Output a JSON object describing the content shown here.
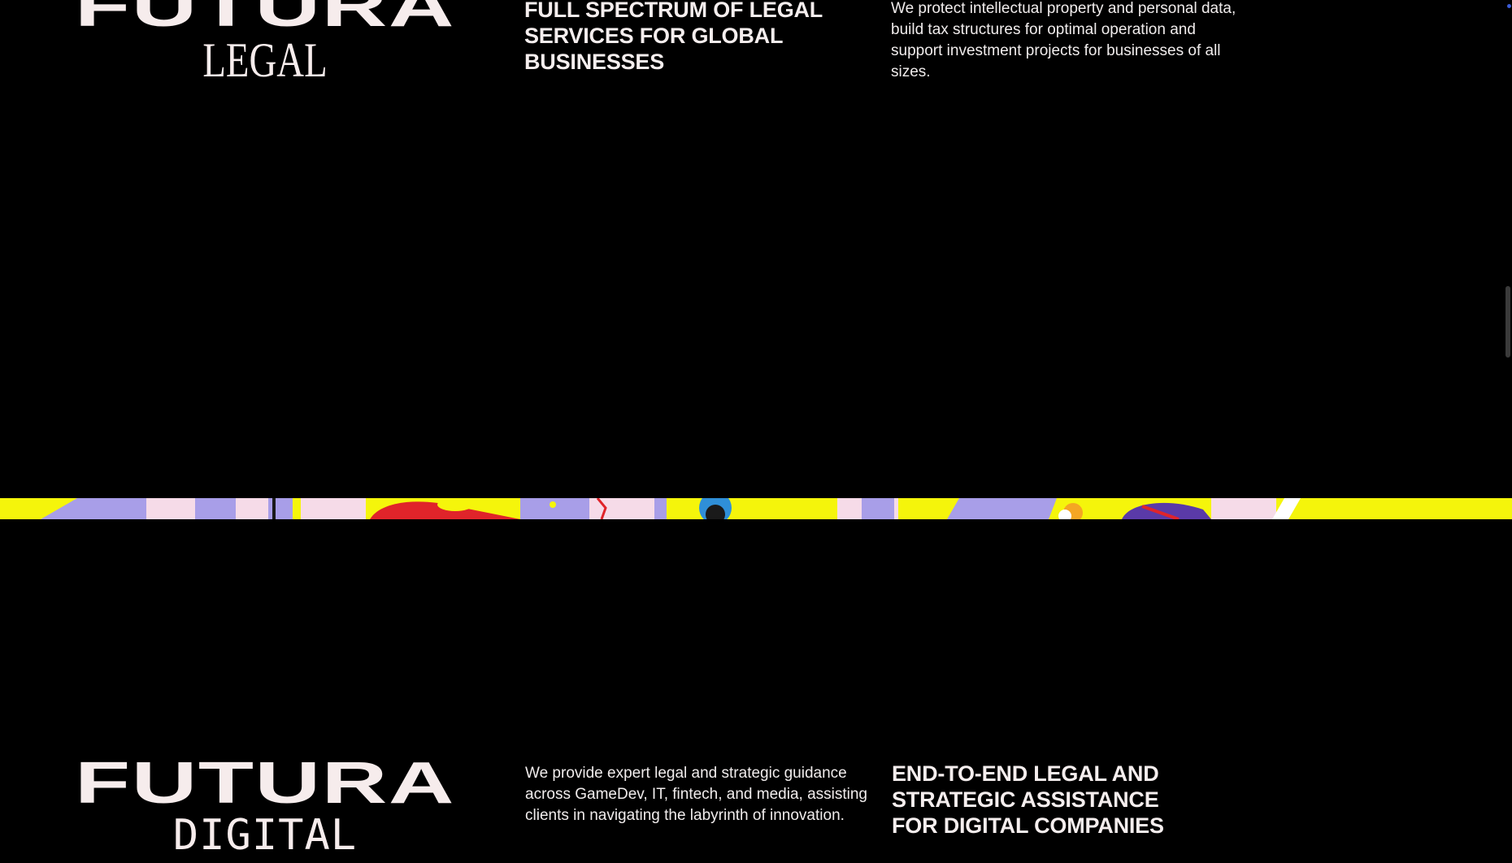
{
  "legal_section": {
    "logo_main": "FUTURA",
    "logo_sub": "LEGAL",
    "heading": "FULL SPECTRUM OF LEGAL\nSERVICES FOR GLOBAL\nBUSINESSES",
    "description": "We protect intellectual property and personal data,\nbuild tax structures for optimal operation and\nsupport investment projects for businesses of all\nsizes."
  },
  "digital_section": {
    "logo_main": "FUTURA",
    "logo_sub": "DIGITAL",
    "description": "We provide expert legal and strategic guidance\nacross GameDev, IT, fintech, and media, assisting\nclients in navigating the labyrinth of innovation.",
    "heading": "END-TO-END LEGAL AND\nSTRATEGIC ASSISTANCE\nFOR DIGITAL COMPANIES"
  },
  "banner": {
    "colors": {
      "yellow": "#f5f50b",
      "lavender": "#a89ee8",
      "pink": "#f6dbe8",
      "red": "#e0242a",
      "purple": "#5a3aa8",
      "blue": "#2f8fd8"
    }
  },
  "colors": {
    "background": "#000000",
    "text": "#f6ecec"
  }
}
